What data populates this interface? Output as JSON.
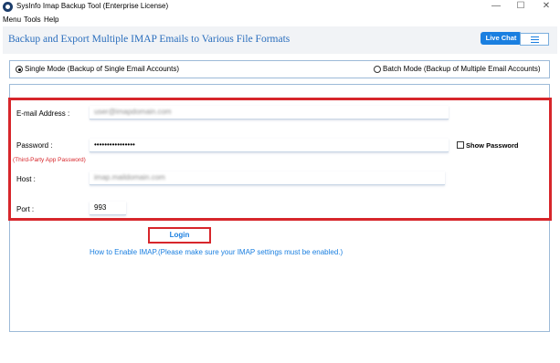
{
  "window": {
    "title": "SysInfo Imap Backup Tool (Enterprise License)",
    "minimize": "—",
    "maximize": "☐",
    "close": "✕"
  },
  "menubar": {
    "items": [
      "Menu",
      "Tools",
      "Help"
    ]
  },
  "header": {
    "title": "Backup and Export Multiple IMAP Emails to Various File Formats",
    "live_chat": "Live Chat",
    "menu_icon": "hamburger-icon"
  },
  "modes": {
    "single": "Single Mode (Backup of Single Email Accounts)",
    "batch": "Batch Mode (Backup of Multiple Email Accounts)",
    "selected": "single"
  },
  "form": {
    "email_label": "E-mail Address :",
    "email_value": "user@imapdomain.com",
    "password_label": "Password :",
    "password_value": "••••••••••••••••",
    "password_hint": "(Third-Party App Password)",
    "show_password_label": "Show Password",
    "host_label": "Host :",
    "host_value": "imap.maildomain.com",
    "port_label": "Port :",
    "port_value": "993"
  },
  "login_label": "Login",
  "help_link": "How to Enable IMAP.(Please make sure your IMAP settings must be enabled.)",
  "colors": {
    "accent": "#1a7fe0",
    "title_blue": "#2a6ebd",
    "highlight_red": "#d7262b"
  }
}
